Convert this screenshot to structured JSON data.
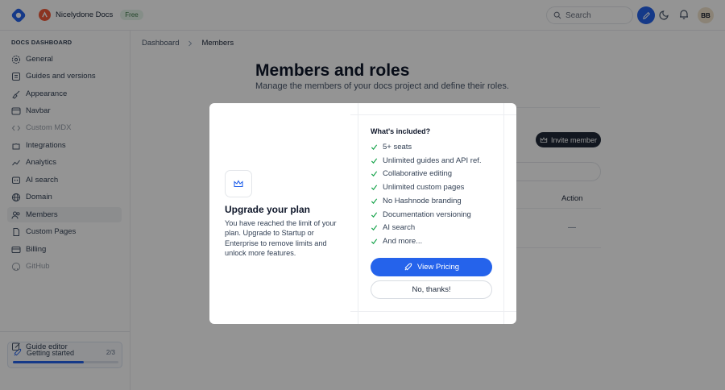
{
  "header": {
    "brand_name": "Nicelydone Docs",
    "plan_badge": "Free",
    "search_placeholder": "Search",
    "avatar_initials": "BB",
    "accent": "#2563eb"
  },
  "sidebar": {
    "title": "DOCS DASHBOARD",
    "items": [
      {
        "label": "General",
        "icon": "gear-icon"
      },
      {
        "label": "Guides and versions",
        "icon": "book-icon"
      },
      {
        "label": "Appearance",
        "icon": "brush-icon"
      },
      {
        "label": "Navbar",
        "icon": "navbar-icon"
      },
      {
        "label": "Custom MDX",
        "icon": "code-icon"
      },
      {
        "label": "Integrations",
        "icon": "puzzle-icon"
      },
      {
        "label": "Analytics",
        "icon": "analytics-icon"
      },
      {
        "label": "AI search",
        "icon": "ai-icon"
      },
      {
        "label": "Domain",
        "icon": "globe-icon"
      },
      {
        "label": "Members",
        "icon": "users-icon"
      },
      {
        "label": "Custom Pages",
        "icon": "pages-icon"
      },
      {
        "label": "Billing",
        "icon": "card-icon"
      },
      {
        "label": "GitHub",
        "icon": "github-icon"
      }
    ],
    "getting_started": {
      "label": "Getting started",
      "count": "2/3",
      "progress": 0.67
    },
    "guide_editor": "Guide editor"
  },
  "breadcrumb": {
    "root": "Dashboard",
    "current": "Members"
  },
  "page": {
    "title": "Members and roles",
    "subtitle": "Manage the members of your docs project and define their roles.",
    "invite_label": "Invite member",
    "action_header": "Action",
    "action_cell": "—"
  },
  "modal": {
    "title": "Upgrade your plan",
    "body": "You have reached the limit of your plan. Upgrade to Startup or Enterprise to remove limits and unlock more features.",
    "included_title": "What's included?",
    "features": [
      "5+ seats",
      "Unlimited guides and API ref.",
      "Collaborative editing",
      "Unlimited custom pages",
      "No Hashnode branding",
      "Documentation versioning",
      "AI search",
      "And more..."
    ],
    "primary_label": "View Pricing",
    "secondary_label": "No, thanks!"
  }
}
